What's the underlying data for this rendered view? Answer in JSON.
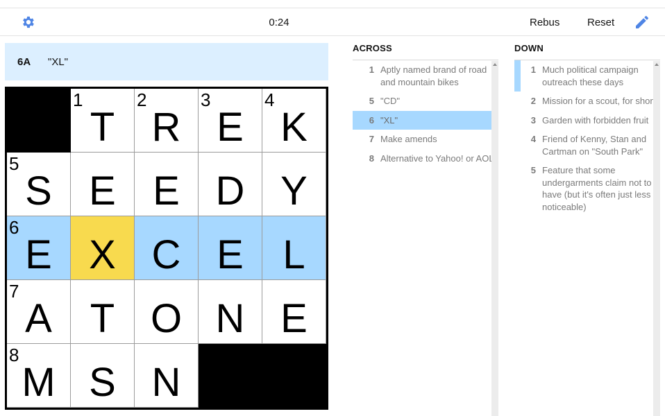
{
  "toolbar": {
    "timer": "0:24",
    "rebus_label": "Rebus",
    "reset_label": "Reset",
    "settings_icon": "gear-icon",
    "pencil_icon": "pencil-icon",
    "accent_color": "#4f85e5"
  },
  "current_clue": {
    "number": "6A",
    "text": "\"XL\""
  },
  "colors": {
    "highlight": "#a7d8ff",
    "selected": "#f8da4e",
    "clue_bar": "#dcefff"
  },
  "grid": {
    "rows": [
      [
        {
          "black": true
        },
        {
          "num": "1",
          "letter": "T"
        },
        {
          "num": "2",
          "letter": "R"
        },
        {
          "num": "3",
          "letter": "E"
        },
        {
          "num": "4",
          "letter": "K"
        }
      ],
      [
        {
          "num": "5",
          "letter": "S"
        },
        {
          "letter": "E"
        },
        {
          "letter": "E"
        },
        {
          "letter": "D"
        },
        {
          "letter": "Y"
        }
      ],
      [
        {
          "num": "6",
          "letter": "E",
          "hl": true
        },
        {
          "letter": "X",
          "sel": true
        },
        {
          "letter": "C",
          "hl": true
        },
        {
          "letter": "E",
          "hl": true
        },
        {
          "letter": "L",
          "hl": true
        }
      ],
      [
        {
          "num": "7",
          "letter": "A"
        },
        {
          "letter": "T"
        },
        {
          "letter": "O"
        },
        {
          "letter": "N"
        },
        {
          "letter": "E"
        }
      ],
      [
        {
          "num": "8",
          "letter": "M"
        },
        {
          "letter": "S"
        },
        {
          "letter": "N"
        },
        {
          "black": true
        },
        {
          "black": true
        }
      ]
    ]
  },
  "across": {
    "title": "ACROSS",
    "clues": [
      {
        "num": "1",
        "text": "Aptly named brand of road and mountain bikes"
      },
      {
        "num": "5",
        "text": "\"CD\""
      },
      {
        "num": "6",
        "text": "\"XL\"",
        "active": true
      },
      {
        "num": "7",
        "text": "Make amends"
      },
      {
        "num": "8",
        "text": "Alternative to Yahoo! or AOL"
      }
    ]
  },
  "down": {
    "title": "DOWN",
    "clues": [
      {
        "num": "1",
        "text": "Much political campaign outreach these days",
        "cross": true
      },
      {
        "num": "2",
        "text": "Mission for a scout, for short"
      },
      {
        "num": "3",
        "text": "Garden with forbidden fruit"
      },
      {
        "num": "4",
        "text": "Friend of Kenny, Stan and Cartman on \"South Park\""
      },
      {
        "num": "5",
        "text": "Feature that some undergarments claim not to have (but it's often just less noticeable)"
      }
    ]
  }
}
